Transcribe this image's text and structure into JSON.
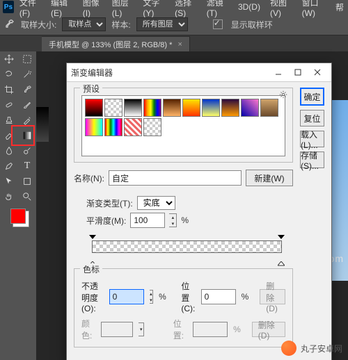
{
  "menu": {
    "items": [
      "文件(F)",
      "编辑(E)",
      "图像(I)",
      "图层(L)",
      "文字(Y)",
      "选择(S)",
      "滤镜(T)",
      "3D(D)",
      "视图(V)",
      "窗口(W)",
      "帮"
    ]
  },
  "options": {
    "sample_size_label": "取样大小:",
    "sample_size_value": "取样点",
    "sample_label": "样本:",
    "sample_value": "所有图层",
    "show_ring_label": "显示取样环"
  },
  "doc": {
    "tab": "手机模型 @ 133% (图层 2, RGB/8) *"
  },
  "dialog": {
    "title": "渐变编辑器",
    "presets_legend": "预设",
    "name_label": "名称(N):",
    "name_value": "自定",
    "new_btn": "新建(W)",
    "right_buttons": {
      "ok": "确定",
      "reset": "复位",
      "load": "载入(L)...",
      "save": "存储(S)..."
    },
    "type_label": "渐变类型(T):",
    "type_value": "实底",
    "smoothness_label": "平滑度(M):",
    "smoothness_value": "100",
    "stops_legend": "色标",
    "opacity_label": "不透明度(O):",
    "opacity_value": "0",
    "location_label": "位置(C):",
    "location_value": "0",
    "color_label": "颜色:",
    "location2_label": "位置:",
    "delete_btn": "删除(D)"
  },
  "watermark": {
    "text": "丸子安卓网",
    "url": "www.wzsqn.com"
  }
}
